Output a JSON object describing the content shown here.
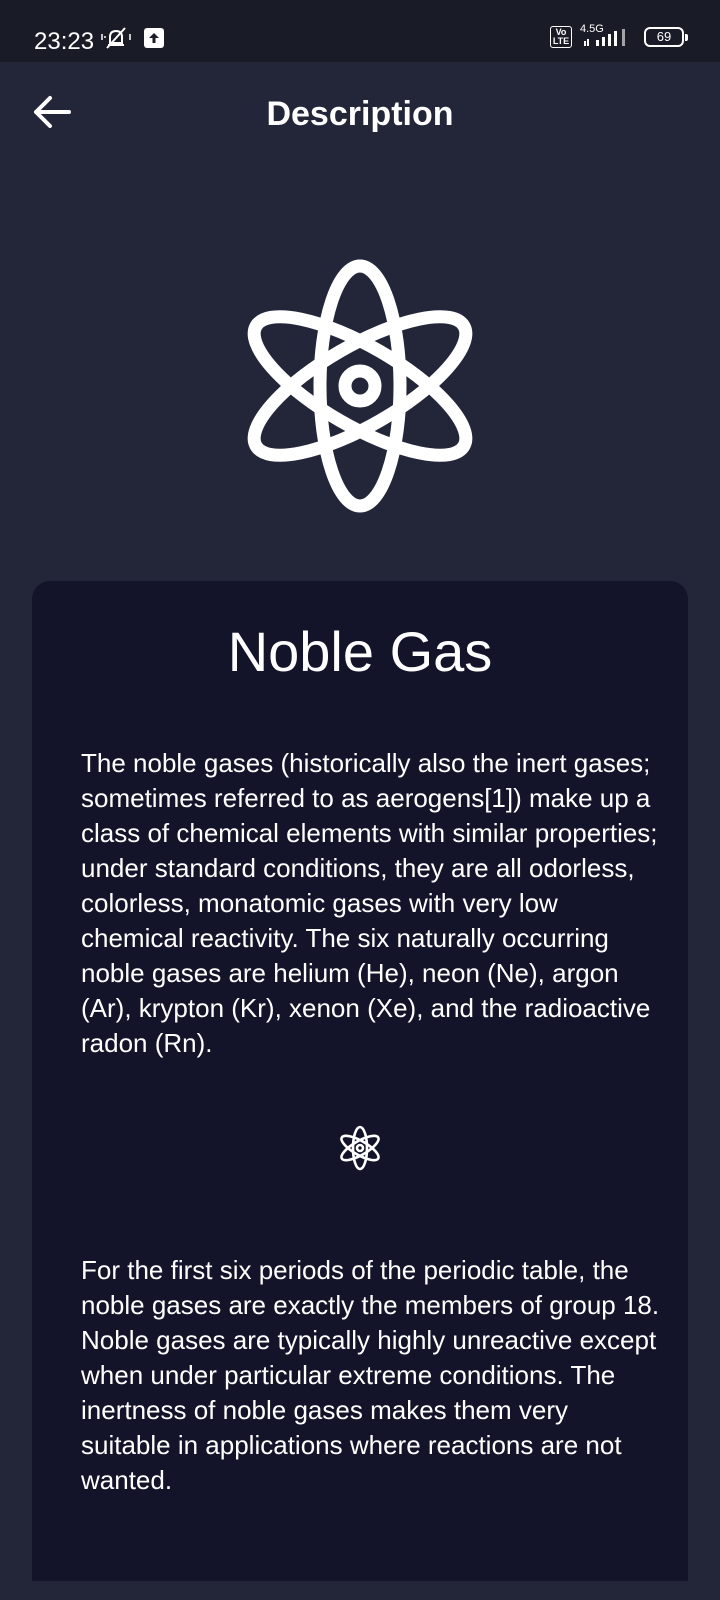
{
  "status_bar": {
    "time": "23:23",
    "network_type": "4.5G",
    "volte_label": "Vo\nLTE",
    "battery_level": "69"
  },
  "header": {
    "title": "Description",
    "back_icon": "arrow-left-icon"
  },
  "hero": {
    "icon": "atom-icon"
  },
  "card": {
    "title": "Noble Gas",
    "paragraphs": [
      "The noble gases (historically also the inert gases; sometimes referred to as aerogens[1]) make up a class of chemical elements with similar properties; under standard conditions, they are all odorless, colorless, monatomic gases with very low chemical reactivity. The six naturally occurring noble gases are helium (He), neon (Ne), argon (Ar), krypton (Kr), xenon (Xe), and the radioactive radon (Rn).",
      "For the first six periods of the periodic table, the noble gases are exactly the members of group 18. Noble gases are typically highly unreactive except when under particular extreme conditions. The inertness of noble gases makes them very suitable in applications where reactions are not wanted."
    ],
    "divider_icon": "atom-icon"
  },
  "colors": {
    "background": "#232638",
    "status_bar": "#191b26",
    "card": "#13142a",
    "text": "#ffffff"
  }
}
